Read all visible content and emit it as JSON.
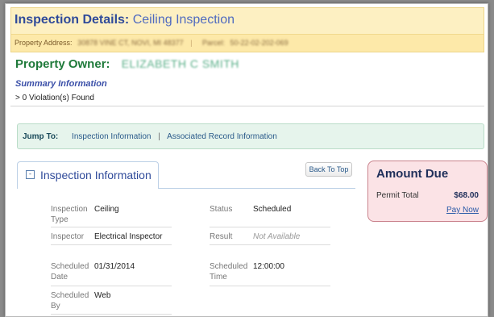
{
  "header": {
    "title_lead": "Inspection Details:",
    "title_subject": "Ceiling Inspection",
    "address_label": "Property Address:",
    "address_value": "30878 VINE CT, NOVI, MI 48377",
    "parcel_label": "Parcel:",
    "parcel_value": "50-22-02-202-069"
  },
  "owner": {
    "label": "Property Owner:",
    "name": "ELIZABETH C SMITH"
  },
  "summary": {
    "label": "Summary Information",
    "violations": "> 0 Violation(s) Found"
  },
  "jump": {
    "label": "Jump To:",
    "link_inspection": "Inspection Information",
    "separator": "|",
    "link_associated": "Associated Record Information"
  },
  "section": {
    "toggle_glyph": "-",
    "title": "Inspection Information",
    "back_to_top": "Back To Top"
  },
  "fields": {
    "inspection_type_label": "Inspection Type",
    "inspection_type_value": "Ceiling",
    "status_label": "Status",
    "status_value": "Scheduled",
    "inspector_label": "Inspector",
    "inspector_value": "Electrical Inspector",
    "result_label": "Result",
    "result_value": "Not Available",
    "scheduled_date_label": "Scheduled Date",
    "scheduled_date_value": "01/31/2014",
    "scheduled_time_label": "Scheduled Time",
    "scheduled_time_value": "12:00:00",
    "scheduled_by_label": "Scheduled By",
    "scheduled_by_value": "Web"
  },
  "amount": {
    "title": "Amount Due",
    "permit_total_label": "Permit Total",
    "permit_total_value": "$68.00",
    "pay_now": "Pay Now"
  },
  "colors": {
    "header_bg": "#fdf0c2",
    "title_blue": "#2f4a9a",
    "owner_green": "#1f7a3a",
    "jump_bg": "#e6f4ec",
    "amount_bg": "#fbe3e6"
  }
}
